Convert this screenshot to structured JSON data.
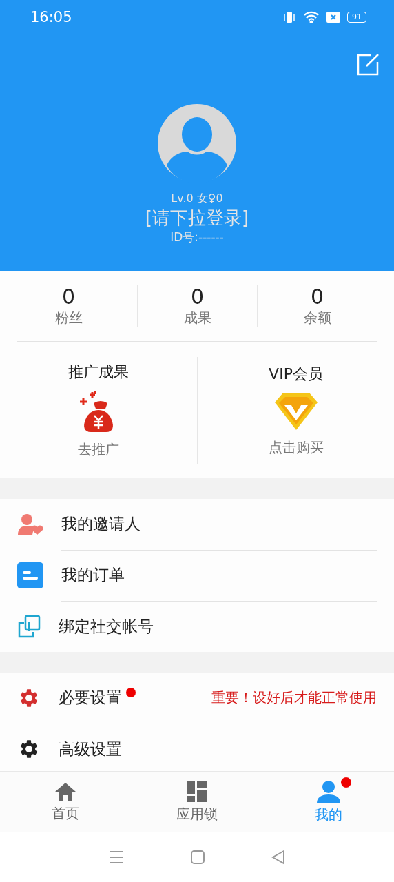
{
  "status_bar": {
    "time": "16:05",
    "battery": "91"
  },
  "profile": {
    "meta": "Lv.0 女♀0",
    "name": "[请下拉登录]",
    "id": "ID号:------"
  },
  "stats": [
    {
      "value": "0",
      "label": "粉丝"
    },
    {
      "value": "0",
      "label": "成果"
    },
    {
      "value": "0",
      "label": "余额"
    }
  ],
  "promos": [
    {
      "kind": "money",
      "title": "推广成果",
      "action": "去推广"
    },
    {
      "kind": "vip",
      "title": "VIP会员",
      "action": "点击购买"
    }
  ],
  "menu_groups": [
    [
      {
        "kind": "inviter",
        "label": "我的邀请人",
        "dot": false
      },
      {
        "kind": "orders",
        "label": "我的订单",
        "dot": false
      },
      {
        "kind": "bind",
        "label": "绑定社交帐号",
        "dot": false
      }
    ],
    [
      {
        "kind": "gear_red",
        "label": "必要设置",
        "dot": true,
        "note": "重要！设好后才能正常使用"
      },
      {
        "kind": "gear_dark",
        "label": "高级设置",
        "dot": false
      }
    ]
  ],
  "tabs": [
    {
      "kind": "home",
      "label": "首页",
      "selected": false,
      "dot": false
    },
    {
      "kind": "grid",
      "label": "应用锁",
      "selected": false,
      "dot": false
    },
    {
      "kind": "user",
      "label": "我的",
      "selected": true,
      "dot": true
    }
  ]
}
